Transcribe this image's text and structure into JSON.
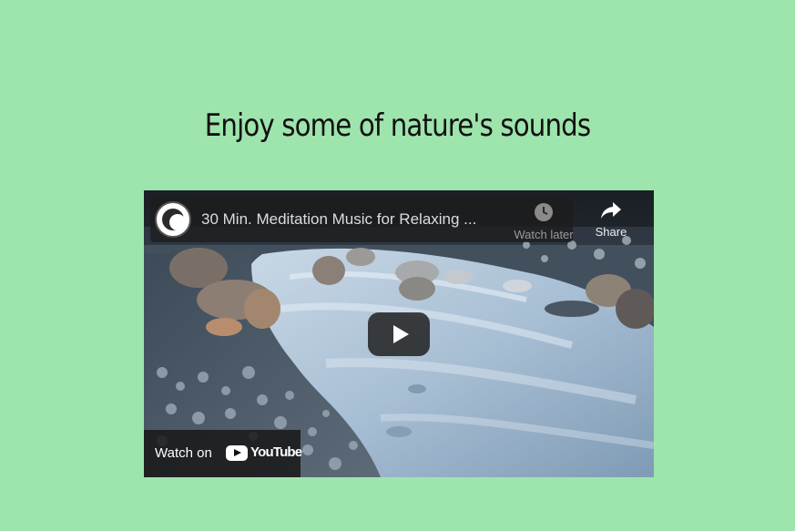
{
  "heading": "Enjoy some of nature's sounds",
  "video": {
    "title": "30 Min. Meditation Music for Relaxing ...",
    "watch_later_label": "Watch later",
    "share_label": "Share",
    "watch_on_label": "Watch on",
    "youtube_wordmark": "YouTube",
    "thumbnail": "river-rapids-rocks"
  },
  "colors": {
    "page_background": "#9ee4ad",
    "overlay": "#1c1c1c"
  }
}
